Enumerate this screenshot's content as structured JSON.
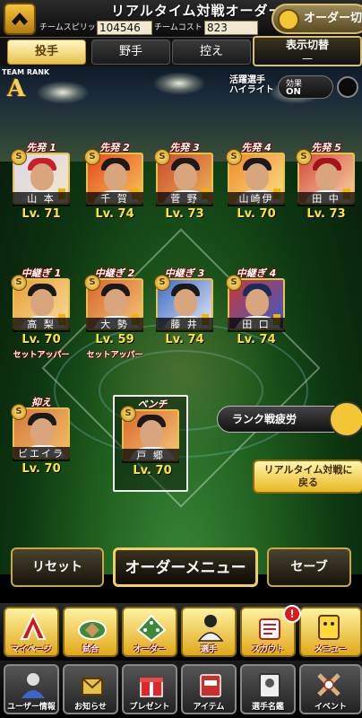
{
  "header": {
    "title": "リアルタイム対戦オーダー",
    "team_spirit_label": "チームスピリッツ",
    "team_spirit_value": "104546",
    "team_cost_label": "チームコスト",
    "team_cost_value": "823",
    "order_switch_label": "オーダー切替"
  },
  "tabs": [
    {
      "label": "投手",
      "active": true
    },
    {
      "label": "野手",
      "active": false
    },
    {
      "label": "控え",
      "active": false
    }
  ],
  "display_toggle": {
    "label": "表示切替",
    "value": "—"
  },
  "team_rank": {
    "label": "TEAM RANK",
    "value": "A"
  },
  "active_player": {
    "label_line1": "活躍選手",
    "label_line2": "ハイライト"
  },
  "effect_toggle": {
    "label": "効果",
    "value": "ON"
  },
  "starters": [
    {
      "position": "先発 1",
      "name": "山 本",
      "level": "Lv. 71",
      "cap_color": "#c8202a"
    },
    {
      "position": "先発 2",
      "name": "千 賀",
      "level": "Lv. 74",
      "cap_color": "#1a1a1a"
    },
    {
      "position": "先発 3",
      "name": "菅 野",
      "level": "Lv. 73",
      "cap_color": "#1a1a1a"
    },
    {
      "position": "先発 4",
      "name": "山崎伊",
      "level": "Lv. 70",
      "cap_color": "#1a1a1a"
    },
    {
      "position": "先発 5",
      "name": "田 中",
      "level": "Lv. 73",
      "cap_color": "#a3131b"
    }
  ],
  "relievers": [
    {
      "position": "中継ぎ 1",
      "name": "高 梨",
      "level": "Lv. 70",
      "sub": "セットアッパー",
      "cap_color": "#1a1a1a"
    },
    {
      "position": "中継ぎ 2",
      "name": "大 勢",
      "level": "Lv. 59",
      "sub": "セットアッパー",
      "cap_color": "#1a1a1a"
    },
    {
      "position": "中継ぎ 3",
      "name": "藤 井",
      "level": "Lv. 74",
      "sub": "",
      "cap_color": "#1a1a1a"
    },
    {
      "position": "中継ぎ 4",
      "name": "田 口",
      "level": "Lv. 74",
      "sub": "",
      "cap_color": "#1a2a5a"
    }
  ],
  "closer": {
    "position": "抑え",
    "name": "ビエイラ",
    "level": "Lv. 70",
    "cap_color": "#1a1a1a"
  },
  "bench": {
    "position": "ベンチ",
    "name": "戸 郷",
    "level": "Lv. 70",
    "cap_color": "#1a1a1a"
  },
  "rank_fatigue_label": "ランク戦疲労",
  "back_button": {
    "line1": "リアルタイム対戦に",
    "line2": "戻る"
  },
  "actions": {
    "reset": "リセット",
    "order_menu": "オーダーメニュー",
    "save": "セーブ"
  },
  "nav_primary": [
    {
      "label": "マイページ",
      "icon": "a-logo-icon"
    },
    {
      "label": "試合",
      "icon": "stadium-icon"
    },
    {
      "label": "オーダー",
      "icon": "formation-icon"
    },
    {
      "label": "選手",
      "icon": "player-icon"
    },
    {
      "label": "スカウト",
      "icon": "scout-icon"
    },
    {
      "label": "メニュー",
      "icon": "menu-icon"
    }
  ],
  "notification_badge": "!",
  "nav_secondary": [
    {
      "label": "ユーザー情報",
      "icon": "user-icon"
    },
    {
      "label": "お知らせ",
      "icon": "notice-icon"
    },
    {
      "label": "プレゼント",
      "icon": "gift-icon"
    },
    {
      "label": "アイテム",
      "icon": "item-icon"
    },
    {
      "label": "選手名鑑",
      "icon": "book-icon"
    },
    {
      "label": "イベント",
      "icon": "event-icon"
    }
  ]
}
